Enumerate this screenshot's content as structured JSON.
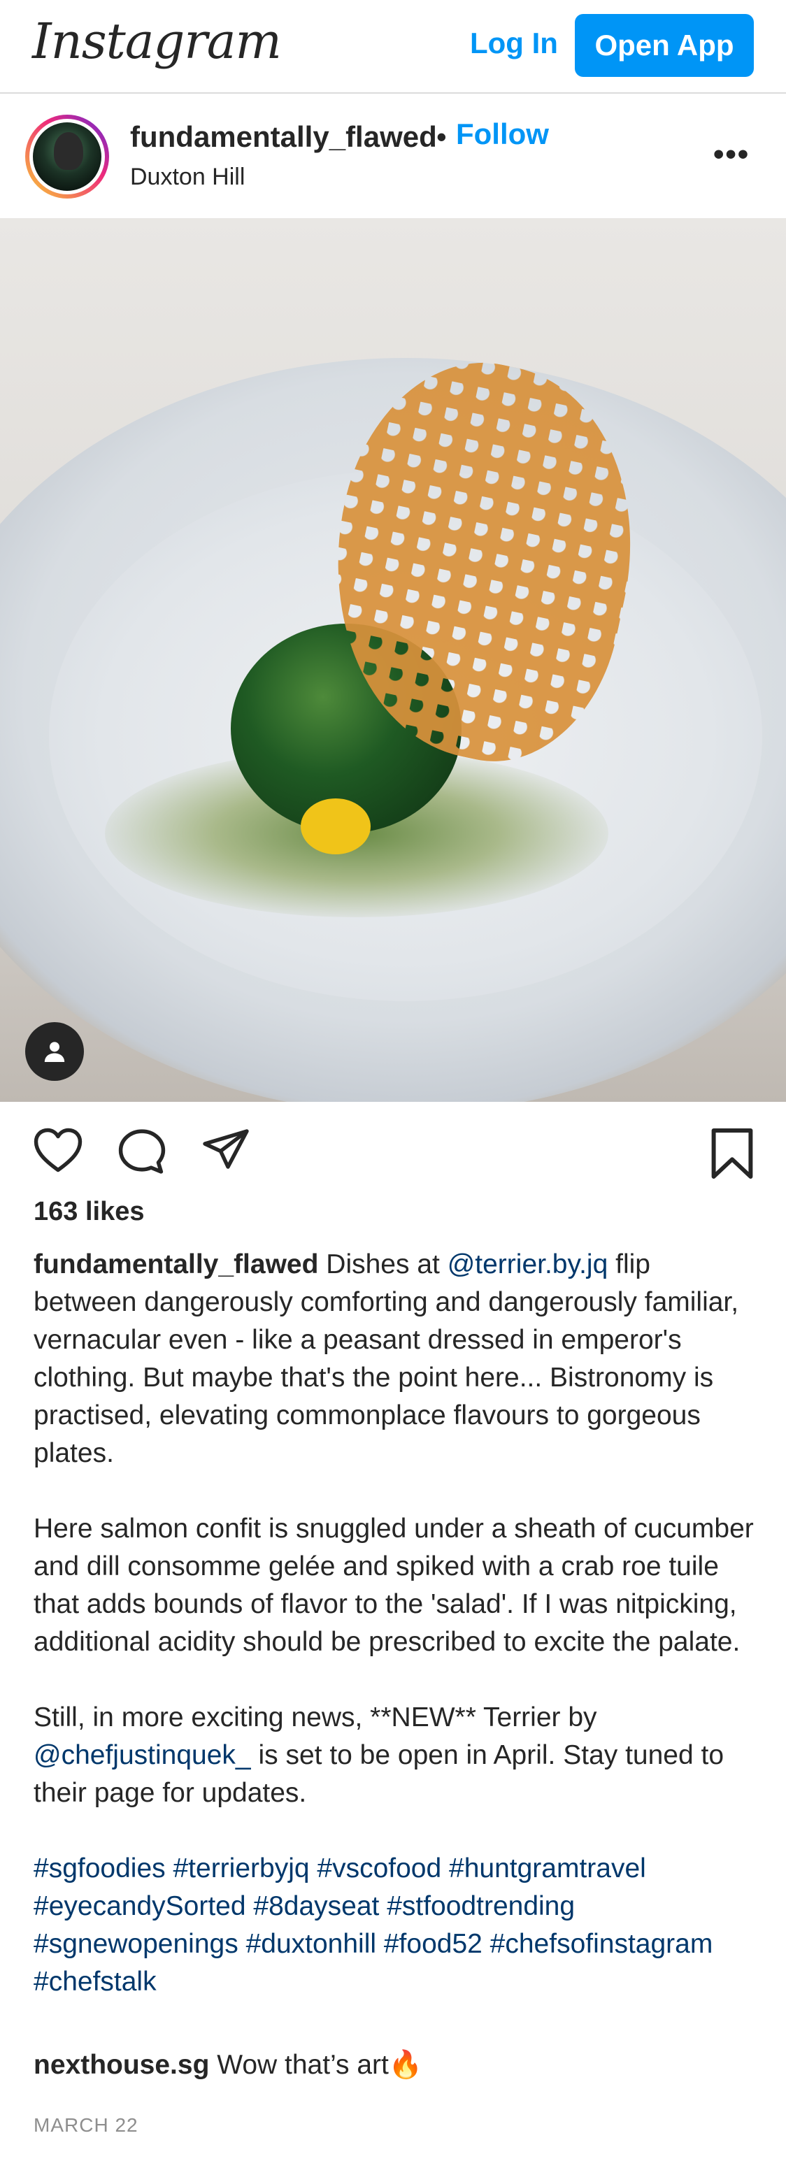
{
  "header": {
    "logo_text": "Instagram",
    "login_label": "Log In",
    "open_app_label": "Open App"
  },
  "post": {
    "username": "fundamentally_flawed",
    "separator": "•",
    "follow_label": "Follow",
    "location": "Duxton Hill",
    "more_label": "•••",
    "likes": "163 likes",
    "caption": {
      "username": "fundamentally_flawed",
      "p1_a": " Dishes at ",
      "p1_mention": "@terrier.by.jq",
      "p1_b": " flip between dangerously comforting and dangerously familiar, vernacular even - like a peasant dressed in emperor's clothing. But maybe that's the point here... Bistronomy is practised, elevating commonplace flavours to gorgeous plates.",
      "p2": "Here salmon confit is snuggled under a sheath of cucumber and dill consomme gelée and spiked with a crab roe tuile that adds bounds of flavor to the 'salad'. If I was nitpicking, additional acidity should be prescribed to excite the palate.",
      "p3_a": "Still, in more exciting news, **NEW** Terrier by ",
      "p3_mention": "@chefjustinquek_",
      "p3_b": " is set to be open in April. Stay tuned to their page for updates.",
      "hashtags": "#sgfoodies #terrierbyjq #vscofood #huntgramtravel #eyecandySorted #8dayseat #stfoodtrending #sgnewopenings #duxtonhill #food52 #chefsofinstagram #chefstalk"
    },
    "comment": {
      "username": "nexthouse.sg",
      "text": " Wow that’s art🔥"
    },
    "date": "MARCH 22"
  },
  "colors": {
    "accent": "#0095f6",
    "mention": "#00376b",
    "text": "#262626",
    "muted": "#8e8e8e"
  },
  "icons": [
    "heart-icon",
    "comment-icon",
    "share-icon",
    "bookmark-icon",
    "user-tag-icon"
  ]
}
